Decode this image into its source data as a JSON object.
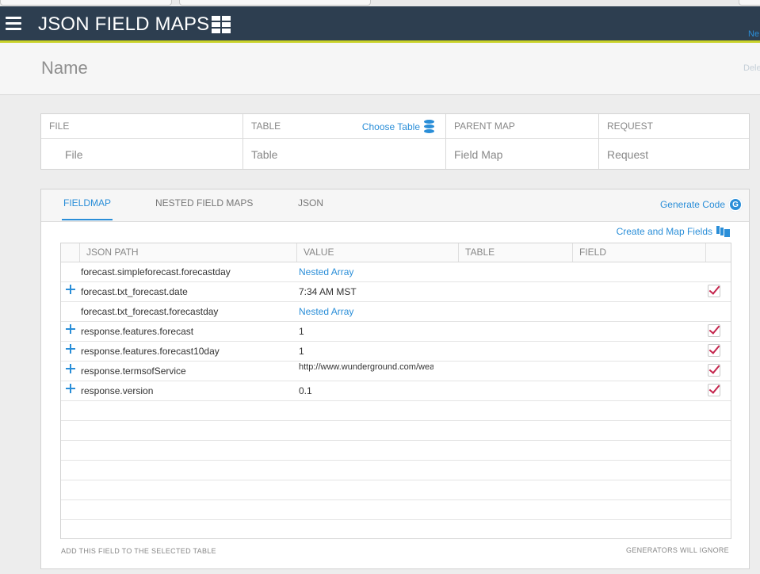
{
  "app": {
    "title": "JSON FIELD MAPS",
    "new_link": "Ne",
    "delete_link": "Dele"
  },
  "record": {
    "name": "Name"
  },
  "info": {
    "file": {
      "label": "FILE",
      "value": "File"
    },
    "table": {
      "label": "TABLE",
      "value": "Table",
      "action": "Choose Table"
    },
    "parent_map": {
      "label": "PARENT MAP",
      "value": "Field Map"
    },
    "request": {
      "label": "REQUEST",
      "value": "Request"
    }
  },
  "tabs": [
    {
      "label": "FIELDMAP",
      "active": true
    },
    {
      "label": "NESTED FIELD MAPS",
      "active": false
    },
    {
      "label": "JSON",
      "active": false
    }
  ],
  "actions": {
    "generate_code": "Generate Code",
    "create_map_fields": "Create and Map Fields"
  },
  "grid": {
    "columns": [
      "JSON PATH",
      "VALUE",
      "TABLE",
      "FIELD"
    ],
    "rows": [
      {
        "path": "forecast.simpleforecast.forecastday",
        "value": "Nested Array",
        "nested": true,
        "checked": false
      },
      {
        "path": "forecast.txt_forecast.date",
        "value": "7:34 AM MST",
        "nested": false,
        "checked": true
      },
      {
        "path": "forecast.txt_forecast.forecastday",
        "value": "Nested Array",
        "nested": true,
        "checked": false
      },
      {
        "path": "response.features.forecast",
        "value": "1",
        "nested": false,
        "checked": true
      },
      {
        "path": "response.features.forecast10day",
        "value": "1",
        "nested": false,
        "checked": true
      },
      {
        "path": "response.termsofService",
        "value": "http://www.wunderground.com/weather/api/d/terms.html",
        "nested": false,
        "checked": true
      },
      {
        "path": "response.version",
        "value": "0.1",
        "nested": false,
        "checked": true
      }
    ],
    "footer_left": "ADD THIS FIELD TO THE SELECTED TABLE",
    "footer_right": "GENERATORS WILL IGNORE"
  },
  "colors": {
    "header_bg": "#2d3e50",
    "header_accent": "#c9d22a",
    "link": "#2a8ed8",
    "check": "#c4234b"
  }
}
